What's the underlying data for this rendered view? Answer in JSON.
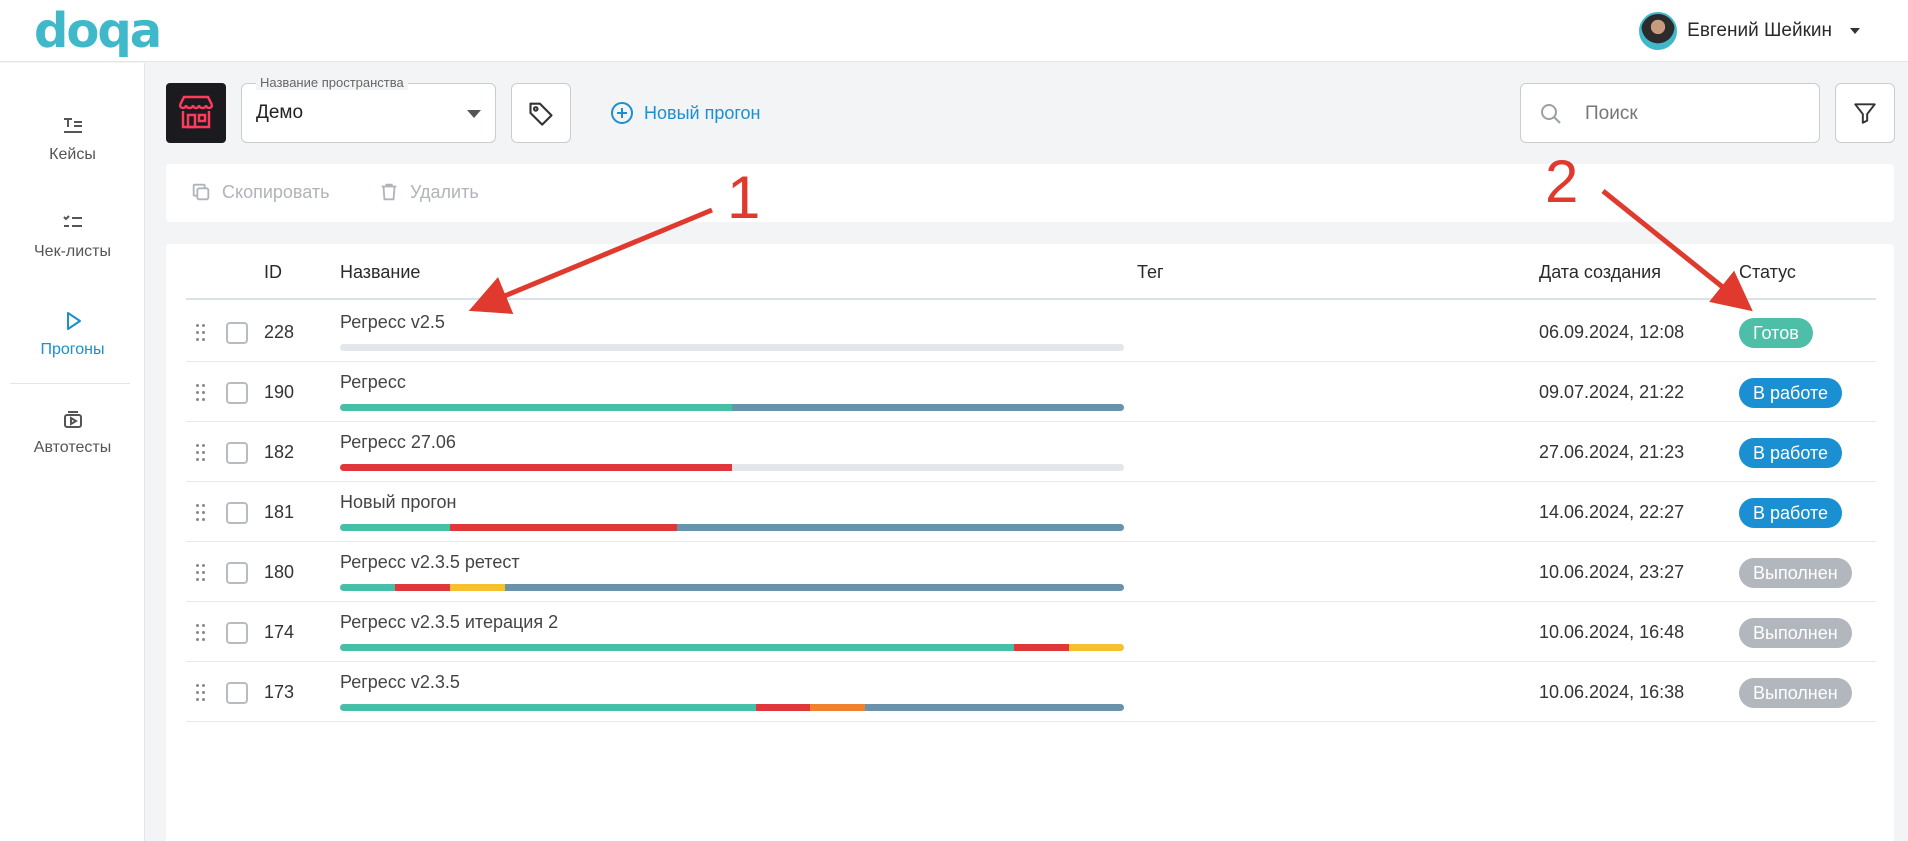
{
  "app": {
    "logo_text": "doqa"
  },
  "user": {
    "name": "Евгений Шейкин"
  },
  "sidebar": {
    "items": [
      {
        "label": "Кейсы",
        "icon": "cases-icon",
        "active": false
      },
      {
        "label": "Чек-листы",
        "icon": "checklist-icon",
        "active": false
      },
      {
        "label": "Прогоны",
        "icon": "play-icon",
        "active": true
      },
      {
        "label": "Автотесты",
        "icon": "autotests-icon",
        "active": false
      }
    ]
  },
  "toolbar": {
    "space_legend": "Название пространства",
    "space_value": "Демо",
    "new_run_label": "Новый прогон",
    "search_placeholder": "Поиск"
  },
  "actions": {
    "copy_label": "Скопировать",
    "delete_label": "Удалить"
  },
  "table": {
    "headers": {
      "id": "ID",
      "name": "Название",
      "tag": "Тег",
      "created": "Дата создания",
      "status": "Статус"
    },
    "rows": [
      {
        "id": "228",
        "name": "Регресс v2.5",
        "tag": "",
        "created": "06.09.2024, 12:08",
        "status": "Готов",
        "status_color": "#4dbfa8",
        "progress": []
      },
      {
        "id": "190",
        "name": "Регресс",
        "tag": "",
        "created": "09.07.2024, 21:22",
        "status": "В работе",
        "status_color": "#1a8fd1",
        "progress": [
          {
            "color": "#45bfa8",
            "share": 0.5
          },
          {
            "color": "#6893aa",
            "share": 0.5
          }
        ]
      },
      {
        "id": "182",
        "name": "Регресс 27.06",
        "tag": "",
        "created": "27.06.2024, 21:23",
        "status": "В работе",
        "status_color": "#1a8fd1",
        "progress": [
          {
            "color": "#e0383a",
            "share": 0.5
          }
        ]
      },
      {
        "id": "181",
        "name": "Новый прогон",
        "tag": "",
        "created": "14.06.2024, 22:27",
        "status": "В работе",
        "status_color": "#1a8fd1",
        "progress": [
          {
            "color": "#45bfa8",
            "share": 0.14
          },
          {
            "color": "#e0383a",
            "share": 0.29
          },
          {
            "color": "#6893aa",
            "share": 0.57
          }
        ]
      },
      {
        "id": "180",
        "name": "Регресс v2.3.5 ретест",
        "tag": "",
        "created": "10.06.2024, 23:27",
        "status": "Выполнен",
        "status_color": "#b2b6bd",
        "progress": [
          {
            "color": "#45bfa8",
            "share": 0.07
          },
          {
            "color": "#e0383a",
            "share": 0.07
          },
          {
            "color": "#f6c12f",
            "share": 0.07
          },
          {
            "color": "#6893aa",
            "share": 0.79
          }
        ]
      },
      {
        "id": "174",
        "name": "Регресс v2.3.5 итерация 2",
        "tag": "",
        "created": "10.06.2024, 16:48",
        "status": "Выполнен",
        "status_color": "#b2b6bd",
        "progress": [
          {
            "color": "#45bfa8",
            "share": 0.86
          },
          {
            "color": "#e0383a",
            "share": 0.07
          },
          {
            "color": "#f6c12f",
            "share": 0.07
          }
        ]
      },
      {
        "id": "173",
        "name": "Регресс v2.3.5",
        "tag": "",
        "created": "10.06.2024, 16:38",
        "status": "Выполнен",
        "status_color": "#b2b6bd",
        "progress": [
          {
            "color": "#45bfa8",
            "share": 0.53
          },
          {
            "color": "#e0383a",
            "share": 0.07
          },
          {
            "color": "#f0822f",
            "share": 0.07
          },
          {
            "color": "#6893aa",
            "share": 0.33
          }
        ]
      }
    ]
  },
  "annotations": {
    "label_1": "1",
    "label_2": "2",
    "arrow_color": "#e03a2f"
  }
}
